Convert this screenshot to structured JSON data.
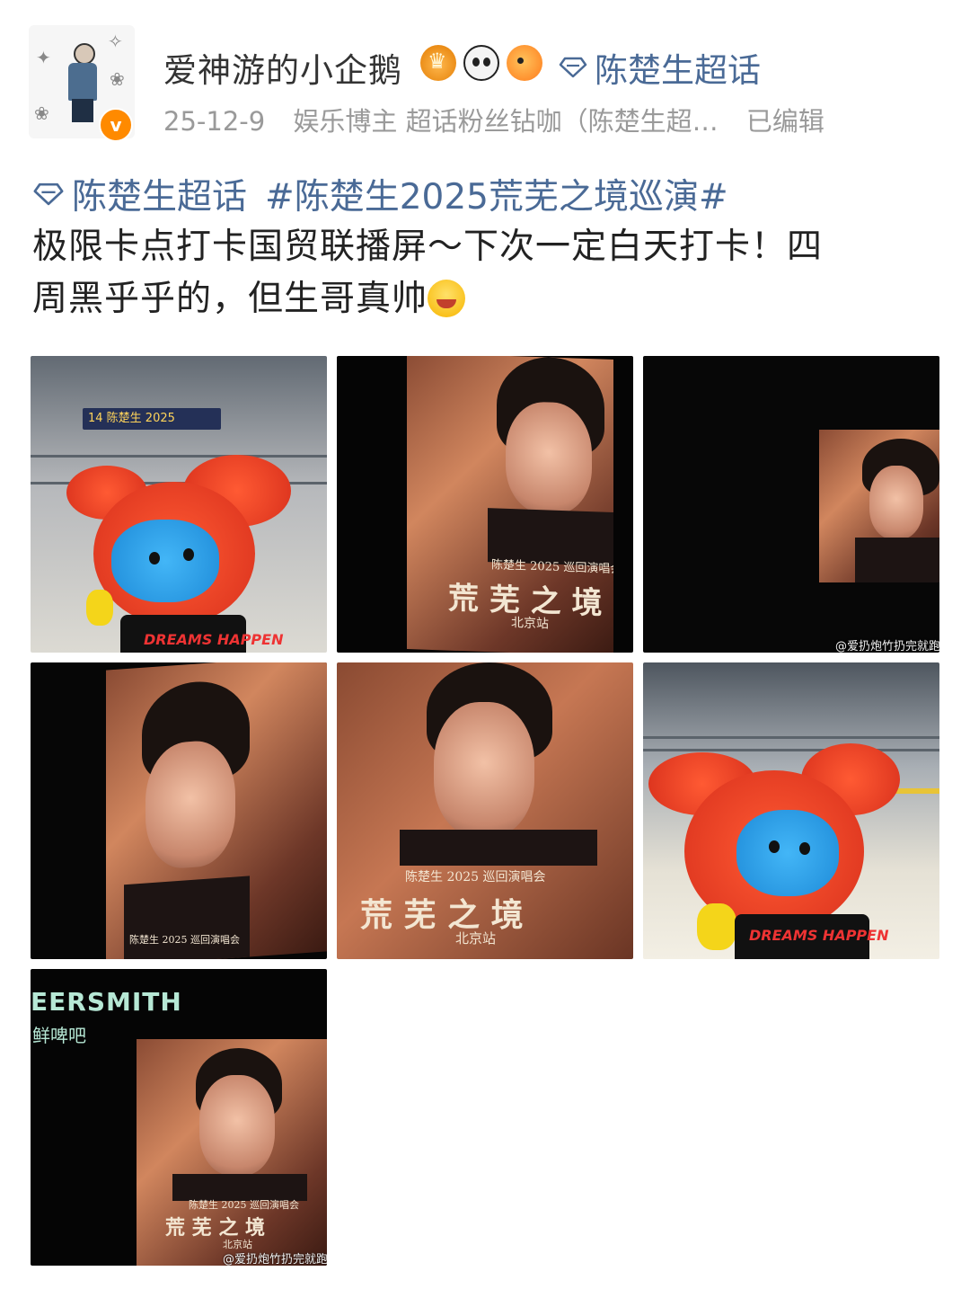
{
  "post": {
    "username": "爱神游的小企鹅",
    "topic_label": "陈楚生超话",
    "meta": {
      "date": "25-12-9",
      "role": "娱乐博主 超话粉丝钻咖（陈楚生超…",
      "edited": "已编辑"
    },
    "text": {
      "topic_tag": "陈楚生超话",
      "hashtag": "#陈楚生2025荒芜之境巡演#",
      "body_line1": "极限卡点打卡国贸联播屏～下次一定白天打卡！四",
      "body_line2": "周黑乎乎的，但生哥真帅"
    },
    "icons": [
      "diamond-icon",
      "crown-badge-icon",
      "panda-badge-icon",
      "fish-badge-icon",
      "verified-icon",
      "laugh-cry-emoji-icon"
    ],
    "images": {
      "poster_tour": "陈楚生 2025 巡回演唱会",
      "poster_title": "荒 芜 之 境",
      "poster_city": "北京站",
      "watermark": "@爱扔炮竹扔完就跑",
      "beersmith": "EERSMITH",
      "beersmith_cn": "鲜啤吧",
      "station_sign": "14 陈楚生 2025",
      "shirt_text": "DREAMS HAPPEN"
    }
  },
  "colors": {
    "link": "#4a6a96",
    "meta": "#9a9a9a",
    "verified": "#ff8a00"
  }
}
